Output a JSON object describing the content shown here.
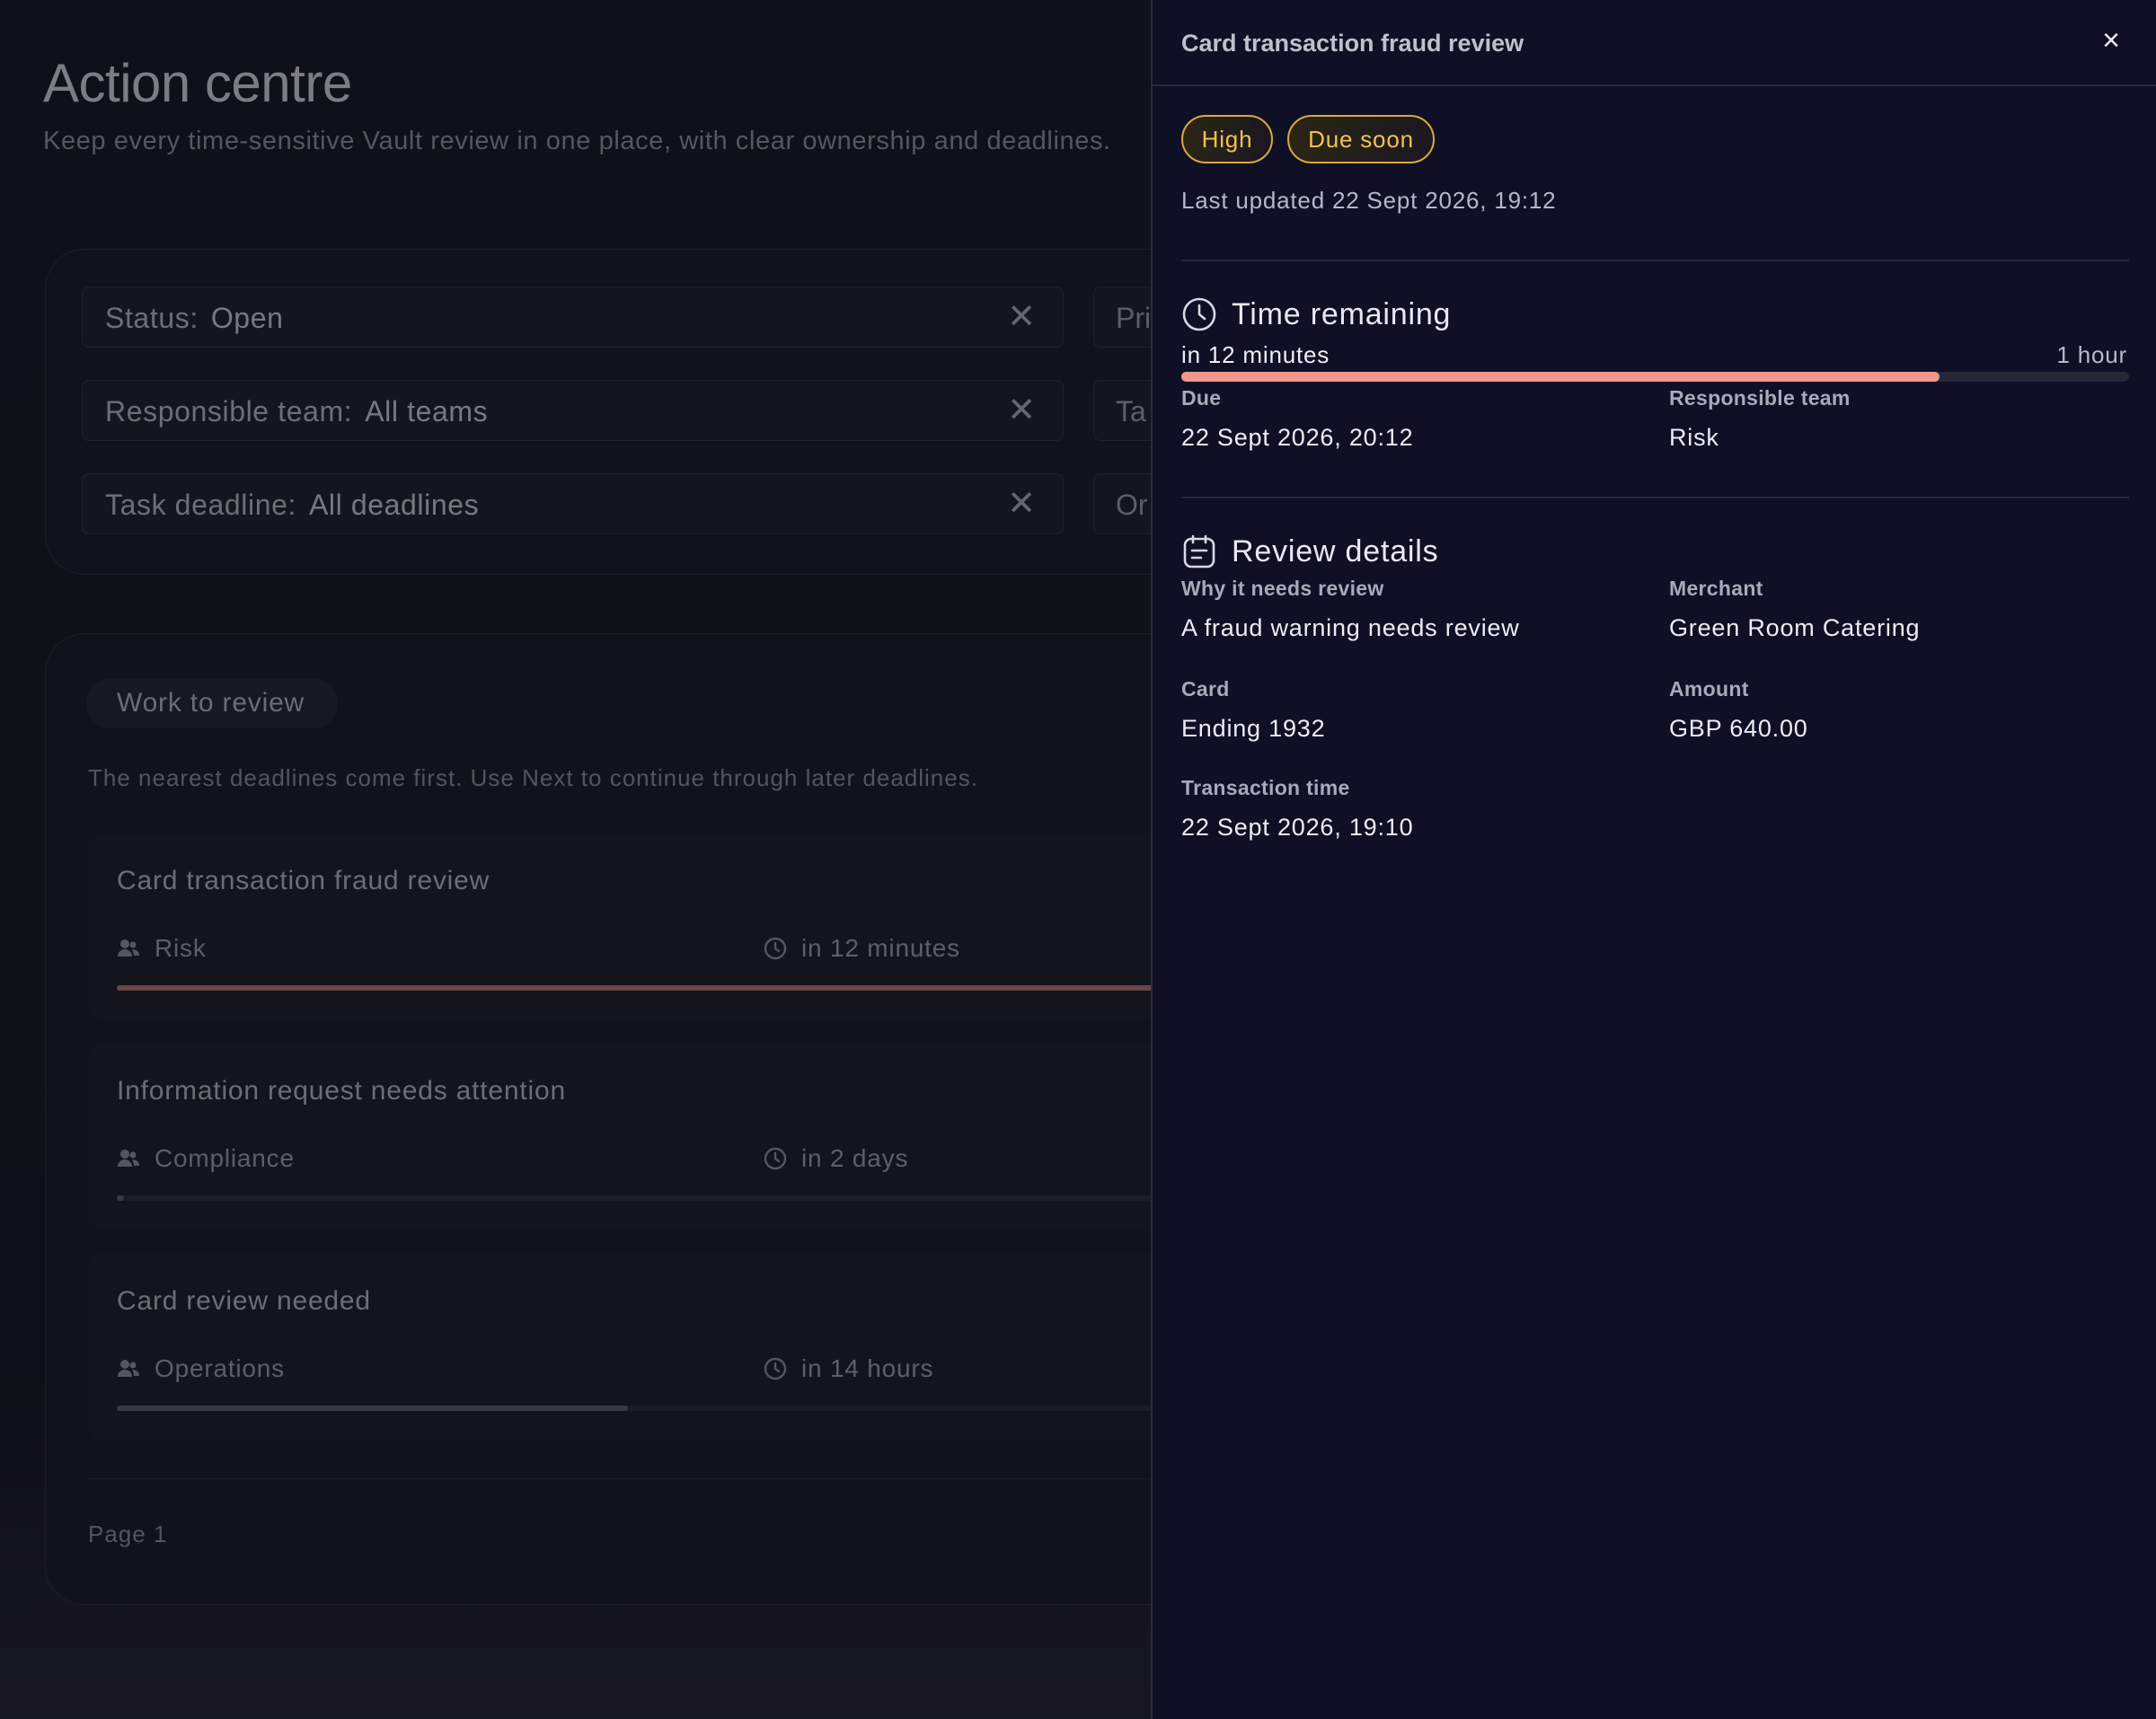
{
  "page": {
    "title": "Action centre",
    "subtitle": "Keep every time-sensitive Vault review in one place, with clear ownership and deadlines."
  },
  "filters": [
    {
      "label": "Status:",
      "value": "Open",
      "clear_icon": "close-icon"
    },
    {
      "label": "Responsible team:",
      "value": "All teams",
      "clear_icon": "close-icon"
    },
    {
      "label": "Task deadline:",
      "value": "All deadlines",
      "clear_icon": "close-icon"
    }
  ],
  "filters_partial": [
    "Pri",
    "Ta",
    "Or"
  ],
  "work": {
    "tab_label": "Work to review",
    "hint": "The nearest deadlines come first. Use Next to continue through later deadlines.",
    "tasks": [
      {
        "title": "Card transaction fraud review",
        "team": "Risk",
        "due": "in 12 minutes",
        "progress": 0.96,
        "color": "#b0736b"
      },
      {
        "title": "Information request needs attention",
        "team": "Compliance",
        "due": "in 2 days",
        "progress": 0.004,
        "color": "#5c5c68"
      },
      {
        "title": "Card review needed",
        "team": "Operations",
        "due": "in 14 hours",
        "progress": 0.455,
        "color": "#5c5c68"
      }
    ],
    "page_label": "Page 1"
  },
  "drawer": {
    "title": "Card transaction fraud review",
    "close_label": "×",
    "badges": [
      "High",
      "Due soon"
    ],
    "badge_color": "#f2c14e",
    "last_updated": "Last updated 22 Sept 2026, 19:12",
    "time_remaining": {
      "heading": "Time remaining",
      "left_label": "in 12 minutes",
      "right_label": "1 hour",
      "progress": 0.8,
      "bar_color": "#f0968a",
      "due_label": "Due",
      "due_value": "22 Sept 2026, 20:12",
      "team_label": "Responsible team",
      "team_value": "Risk"
    },
    "review": {
      "heading": "Review details",
      "fields": [
        {
          "label": "Why it needs review",
          "value": "A fraud warning needs review"
        },
        {
          "label": "Merchant",
          "value": "Green Room Catering"
        },
        {
          "label": "Card",
          "value": "Ending 1932"
        },
        {
          "label": "Amount",
          "value": "GBP 640.00"
        },
        {
          "label": "Transaction time",
          "value": "22 Sept 2026, 19:10"
        }
      ]
    }
  }
}
